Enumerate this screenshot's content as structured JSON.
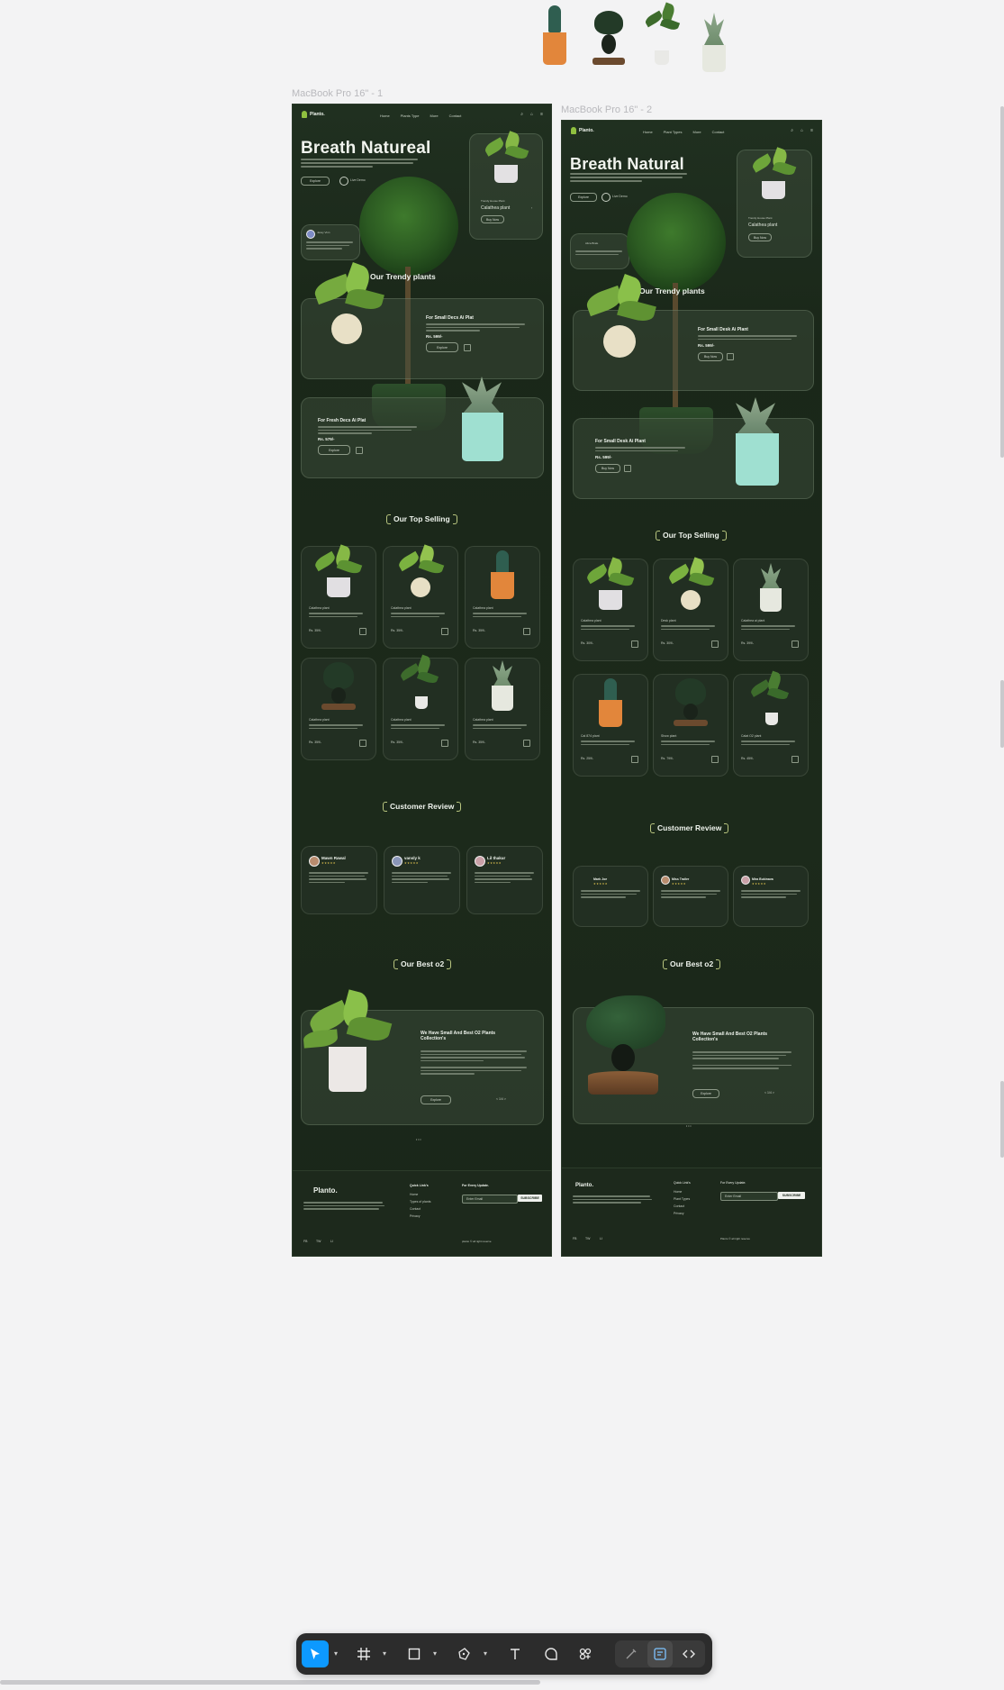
{
  "canvas": {
    "frame1_label": "MacBook Pro 16\" - 1",
    "frame2_label": "MacBook Pro 16\" - 2"
  },
  "frame1": {
    "brand": "Planto.",
    "nav": [
      "Home",
      "Plants Type",
      "More",
      "Contact"
    ],
    "hero_title": "Breath Natureal",
    "explore_label": "Explore",
    "live_label": "Live Demo",
    "review_name": "Jessy Vinn",
    "hero_card_caption": "Trendy House Plant",
    "hero_card_title": "Calathea plant",
    "hero_card_btn": "Buy Now",
    "trendy_title": "Our Trendy plants",
    "trendy1": {
      "title": "For Small Decs Ai Plat",
      "price": "Rs. 599/-",
      "btn": "Explore"
    },
    "trendy2": {
      "title": "For Fresh Decs Ai Plat",
      "price": "Rs. 579/-",
      "btn": "Explore"
    },
    "top_selling_title": "Our Top Selling",
    "products": [
      {
        "name": "Calathea plant",
        "price": "Rs. 359/-"
      },
      {
        "name": "Calathea plant",
        "price": "Rs. 359/-"
      },
      {
        "name": "Calathea plant",
        "price": "Rs. 359/-"
      },
      {
        "name": "Calathea plant",
        "price": "Rs. 359/-"
      },
      {
        "name": "Calathea plant",
        "price": "Rs. 359/-"
      },
      {
        "name": "Calathea plant",
        "price": "Rs. 359/-"
      }
    ],
    "review_title": "Customer Review",
    "reviews": [
      {
        "name": "Mawn Rawal",
        "stars": "★★★★★"
      },
      {
        "name": "vansly k",
        "stars": "★★★★★"
      },
      {
        "name": "Lil thakur",
        "stars": "★★★★★"
      }
    ],
    "best_title": "Our Best o2",
    "best_heading": "We Have Small And Best O2 Plants Collection's",
    "best_btn": "Explore",
    "best_nav": "< 1/4 >",
    "footer": {
      "brand": "Planto.",
      "quick_links_title": "Quick Link's",
      "quick_links": [
        "Home",
        "Types of plants",
        "Contact",
        "Privacy"
      ],
      "updates_title": "For Every Update.",
      "email_placeholder": "Enter Email",
      "subscribe": "SUBSCRIBE",
      "socials": [
        "FB",
        "TW",
        "LI"
      ],
      "copyright": "planto © all right reserve"
    }
  },
  "frame2": {
    "brand": "Planto.",
    "nav": [
      "Home",
      "Plant Types",
      "More",
      "Contact"
    ],
    "hero_title": "Breath Natural",
    "explore_label": "Explore",
    "live_label": "Live Demo",
    "review_name": "Alica Brale",
    "hero_card_caption": "Trendy House Plant",
    "hero_card_title": "Calathea plant",
    "hero_card_btn": "Buy Now",
    "trendy_title": "Our Trendy plants",
    "trendy1": {
      "title": "For Small Desk Ai Plant",
      "price": "Rs. 599/-",
      "btn": "Buy Now"
    },
    "trendy2": {
      "title": "For Small Desk Ai Plant",
      "price": "Rs. 599/-",
      "btn": "Buy Now"
    },
    "top_selling_title": "Our Top Selling",
    "products": [
      {
        "name": "Calathea plant",
        "price": "Rs. 309/-"
      },
      {
        "name": "Desk plant",
        "price": "Rs. 309/-"
      },
      {
        "name": "Calathea ai plant",
        "price": "Rs. 399/-"
      },
      {
        "name": "Cal 874 plant",
        "price": "Rs. 259/-"
      },
      {
        "name": "Show plant",
        "price": "Rs. 799/-"
      },
      {
        "name": "Calat O2 plant",
        "price": "Rs. 459/-"
      }
    ],
    "review_title": "Customer Review",
    "reviews": [
      {
        "name": "Mark Joe",
        "stars": "★★★★★"
      },
      {
        "name": "Miss Trailer",
        "stars": "★★★★★"
      },
      {
        "name": "Mira Bukinava",
        "stars": "★★★★★"
      }
    ],
    "best_title": "Our Best o2",
    "best_heading": "We Have Small And Best O2 Plants Collection's",
    "best_btn": "Explore",
    "best_nav": "< 1/4 >",
    "footer": {
      "brand": "Planto.",
      "quick_links_title": "Quick Link's",
      "quick_links": [
        "Home",
        "Plant Types",
        "Contact",
        "Privacy"
      ],
      "updates_title": "For Every Update.",
      "email_placeholder": "Enter Email",
      "subscribe": "SUBSCRIBE",
      "socials": [
        "FB",
        "TW",
        "LI"
      ],
      "copyright": "Planto © all right reserve"
    }
  },
  "toolbar": {
    "tools": [
      "move-tool",
      "frame-tool",
      "shape-tool",
      "pen-tool",
      "text-tool",
      "comment-tool",
      "components-tool",
      "draw-mode",
      "design-mode",
      "dev-mode"
    ],
    "selected": "move-tool",
    "accent": "#0d99ff"
  },
  "colors": {
    "page_bg": "#f3f3f4",
    "frame_bg": "#1e2a1d",
    "accent_leaf": "#8fc03f"
  }
}
